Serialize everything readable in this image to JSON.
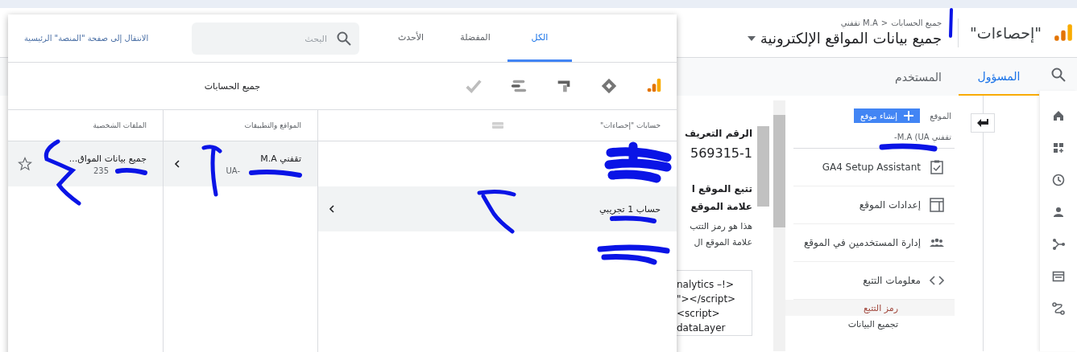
{
  "header": {
    "app_name": "\"إحصاءات\"",
    "breadcrumb": [
      "جميع الحسابات",
      "تقفني M.A"
    ],
    "breadcrumb_separator": ">",
    "title": "جميع بيانات المواقع الإلكترونية"
  },
  "admin_tabs": [
    {
      "label": "المسؤول",
      "selected": true
    },
    {
      "label": "المستخدم",
      "selected": false
    }
  ],
  "property_column": {
    "label": "الموقع",
    "create_button": "إنشاء موقع",
    "current": "تقفني M.A (UA-",
    "items": [
      {
        "label": "GA4 Setup Assistant"
      },
      {
        "label": "إعدادات الموقع"
      },
      {
        "label": "إدارة المستخدمين في الموقع"
      },
      {
        "label": "معلومات التتبع",
        "children": [
          {
            "label": "رمز التتبع",
            "selected": true
          },
          {
            "label": "تجميع البيانات",
            "selected": false
          }
        ]
      }
    ]
  },
  "view_column": {
    "id_heading": "الرقم التعريف",
    "id_value": "569315-1",
    "section_heading": "تتبع الموقع ا",
    "tag_heading": "علامة الموقع",
    "description": [
      "هذا هو رمز التتب",
      "علامة الموقع ال"
    ],
    "code_lines": [
      "nalytics –!>",
      "\"></script>",
      "<script>",
      "dataLayer"
    ]
  },
  "popup": {
    "tabs": [
      {
        "label": "الكل",
        "selected": true
      },
      {
        "label": "المفضلة",
        "selected": false
      },
      {
        "label": "الأحدث",
        "selected": false
      }
    ],
    "search": {
      "placeholder": "البحث"
    },
    "home_link": "الانتقال إلى صفحة \"المنصة\" الرئيسية",
    "scope": "جميع الحسابات",
    "columns": [
      {
        "header": "حسابات \"إحصاءات\"",
        "rows": [
          {
            "selected": false
          },
          {
            "name": "حساب 1 تجريبي",
            "selected": true
          },
          {
            "selected": false
          }
        ]
      },
      {
        "header": "المواقع والتطبيقات",
        "rows": [
          {
            "name": "تقفني M.A",
            "id": "UA-",
            "selected": true
          }
        ]
      },
      {
        "header": "الملفات الشخصية",
        "rows": [
          {
            "name": "جميع بيانات المواق...",
            "id": "235",
            "selected": true
          }
        ]
      }
    ]
  }
}
